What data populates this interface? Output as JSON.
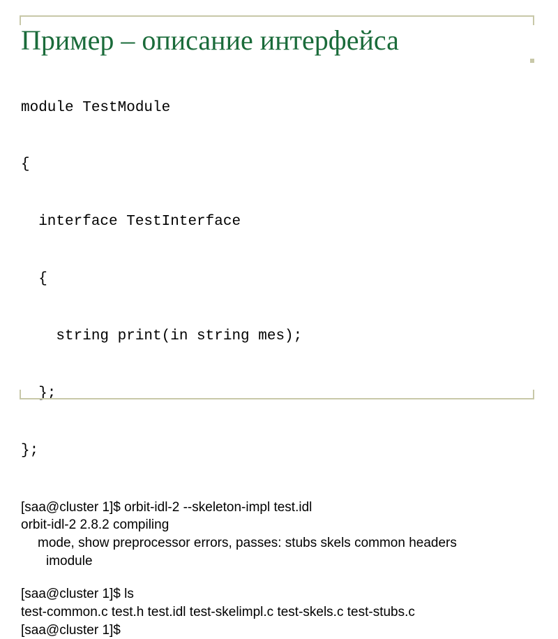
{
  "title": "Пример – описание интерфейса",
  "code": {
    "l1": "module TestModule",
    "l2": "{",
    "l3": "  interface TestInterface",
    "l4": "  {",
    "l5": "    string print(in string mes);",
    "l6": "  };",
    "l7": "};"
  },
  "term": {
    "cmd1": "[saa@cluster 1]$ orbit-idl-2 --skeleton-impl test.idl",
    "out1": "orbit-idl-2 2.8.2 compiling",
    "out2a": "mode, show preprocessor errors, passes: stubs skels common headers",
    "out2b": "imodule",
    "cmd2": "[saa@cluster 1]$ ls",
    "out3": "test-common.c  test.h  test.idl  test-skelimpl.c  test-skels.c  test-stubs.c",
    "cmd3": "[saa@cluster 1]$"
  }
}
